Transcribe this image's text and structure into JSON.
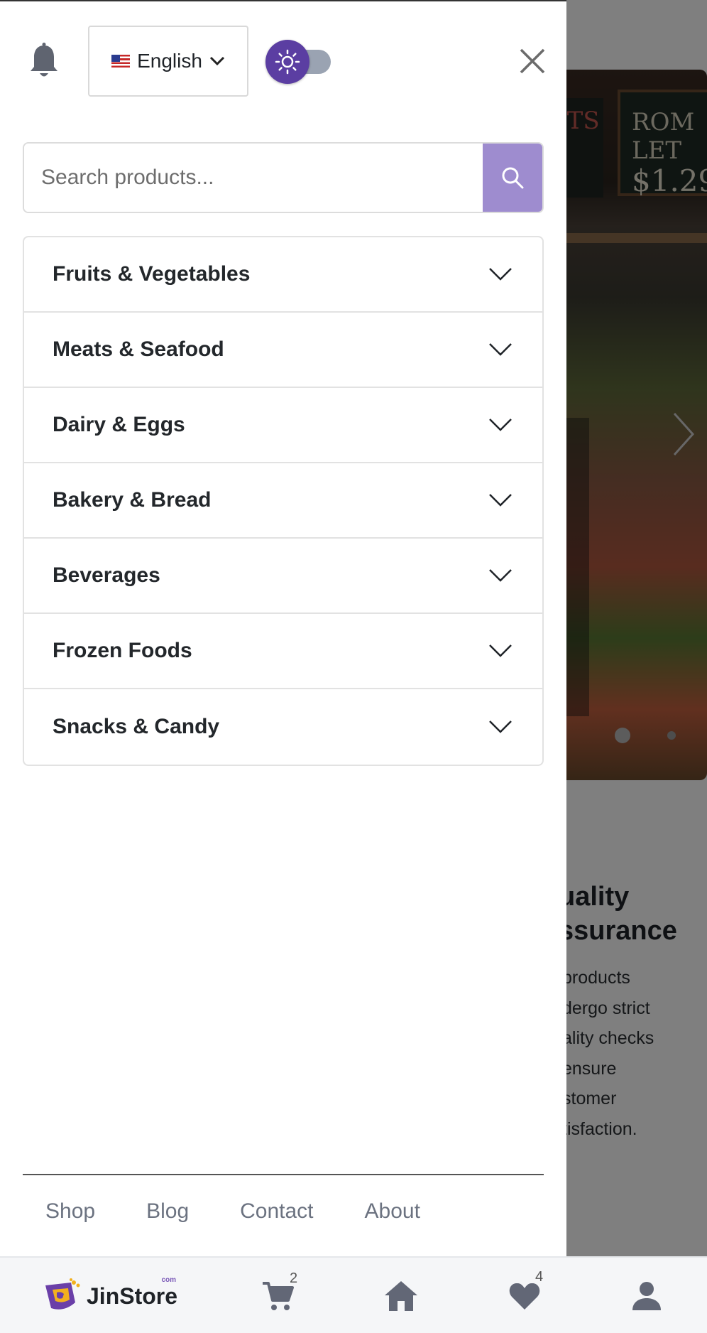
{
  "background_page": {
    "hero_sign_text": "ROM\nLET",
    "hero_sign_text_left": "UTS",
    "hero_price": "$1.29",
    "section_title": "uality\nssurance",
    "section_desc": "products\ndergo strict\nality checks\nensure\nstomer\ntisfaction."
  },
  "header": {
    "language": "English",
    "flag_icon": "us-flag-icon",
    "theme_toggle_state": "light"
  },
  "search": {
    "placeholder": "Search products..."
  },
  "categories": [
    {
      "label": "Fruits & Vegetables"
    },
    {
      "label": "Meats & Seafood"
    },
    {
      "label": "Dairy & Eggs"
    },
    {
      "label": "Bakery & Bread"
    },
    {
      "label": "Beverages"
    },
    {
      "label": "Frozen Foods"
    },
    {
      "label": "Snacks & Candy"
    }
  ],
  "footer_links": [
    "Shop",
    "Blog",
    "Contact",
    "About"
  ],
  "bottom_nav": {
    "brand": "JinStore",
    "brand_suffix": "com",
    "cart_count": "2",
    "wishlist_count": "4"
  },
  "colors": {
    "accent": "#5b3ea2",
    "search_button": "#9e8ccf",
    "text": "#23272b",
    "muted": "#6b7280"
  }
}
